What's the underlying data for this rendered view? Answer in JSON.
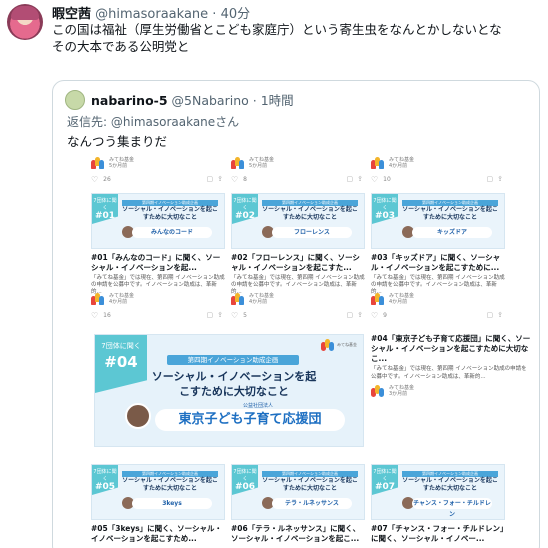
{
  "author": {
    "name": "暇空茜",
    "handle": "@himasoraakane",
    "separator": "·",
    "time": "40分"
  },
  "tweet_text": "この国は福祉（厚生労働省とこども家庭庁）という寄生虫をなんとかしないとな\nその大本である公明党と",
  "quoted": {
    "name": "nabarino-5",
    "handle": "@5Nabarino",
    "separator": "·",
    "time": "1時間",
    "reply_prefix": "返信先:",
    "reply_handle": "@himasoraakaneさん",
    "text": "なんつう集まりだ"
  },
  "cards": [
    {
      "src": "みてね基金",
      "src_sub": "5か月前",
      "likes": "26",
      "tag_label": "7団体に聞く",
      "tag_num": "#01",
      "band": "第四期イノベーション助成企画",
      "thumb_title": "ソーシャル・イノベーションを起こすために大切なこと",
      "org": "みんなのコード",
      "caption": "#01「みんなのコード」に聞く、ソーシャル・イノベーションを起...",
      "desc": "「みてね基金」では現在、第四期 イノベーション助成の申請を公募中です。イノベーション助成は、革新的..."
    },
    {
      "src": "みてね基金",
      "src_sub": "5か月前",
      "likes": "8",
      "tag_label": "7団体に聞く",
      "tag_num": "#02",
      "band": "第四期イノベーション助成企画",
      "thumb_title": "ソーシャル・イノベーションを起こすために大切なこと",
      "org": "フローレンス",
      "caption": "#02「フローレンス」に聞く、ソーシャル・イノベーションを起こすた...",
      "desc": "「みてね基金」では現在、第四期 イノベーション助成の申請を公募中です。イノベーション助成は、革新的..."
    },
    {
      "src": "みてね基金",
      "src_sub": "4か月前",
      "likes": "10",
      "tag_label": "7団体に聞く",
      "tag_num": "#03",
      "band": "第四期イノベーション助成企画",
      "thumb_title": "ソーシャル・イノベーションを起こすために大切なこと",
      "org": "キッズドア",
      "caption": "#03「キッズドア」に聞く、ソーシャル・イノベーションを起こすために...",
      "desc": "「みてね基金」では現在、第四期 イノベーション助成の申請を公募中です。イノベーション助成は、革新的..."
    }
  ],
  "row2_meta": [
    {
      "src": "みてね基金",
      "src_sub": "4か月前",
      "likes": "16"
    },
    {
      "src": "みてね基金",
      "src_sub": "4か月前",
      "likes": "5"
    },
    {
      "src": "みてね基金",
      "src_sub": "4か月前",
      "likes": "9"
    }
  ],
  "featured": {
    "tag_label": "7団体に聞く",
    "tag_num": "#04",
    "band": "第四期イノベーション助成企画",
    "title": "ソーシャル・イノベーションを起こすために大切なこと",
    "org_prefix": "公益社団法人",
    "org": "東京子ども子育て応援団",
    "logo_text": "みてね基金",
    "caption": "#04「東京子ども子育て応援団」に聞く、ソーシャル・イノベーションを起こすために大切なこ...",
    "desc": "「みてね基金」では現在、第四期 イノベーション助成の申請を公募中です。イノベーション助成は、革新的...",
    "src": "みてね基金",
    "src_sub": "3か月前"
  },
  "bottom_cards": [
    {
      "tag_label": "7団体に聞く",
      "tag_num": "#05",
      "band": "第四期イノベーション助成企画",
      "thumb_title": "ソーシャル・イノベーションを起こすために大切なこと",
      "org": "3keys",
      "caption": "#05「3keys」に聞く、ソーシャル・イノベーションを起こすため..."
    },
    {
      "tag_label": "7団体に聞く",
      "tag_num": "#06",
      "band": "第四期イノベーション助成企画",
      "thumb_title": "ソーシャル・イノベーションを起こすために大切なこと",
      "org": "テラ・ルネッサンス",
      "caption": "#06「テラ・ルネッサンス」に聞く、ソーシャル・イノベーションを起こ..."
    },
    {
      "tag_label": "7団体に聞く",
      "tag_num": "#07",
      "band": "第四期イノベーション助成企画",
      "thumb_title": "ソーシャル・イノベーションを起こすために大切なこと",
      "org": "チャンス・フォー・チルドレン",
      "caption": "#07「チャンス・フォー・チルドレン」に聞く、ソーシャル・イノベー..."
    }
  ],
  "icons": [
    "heart-icon",
    "reply-icon",
    "share-icon",
    "bookmark-icon"
  ]
}
